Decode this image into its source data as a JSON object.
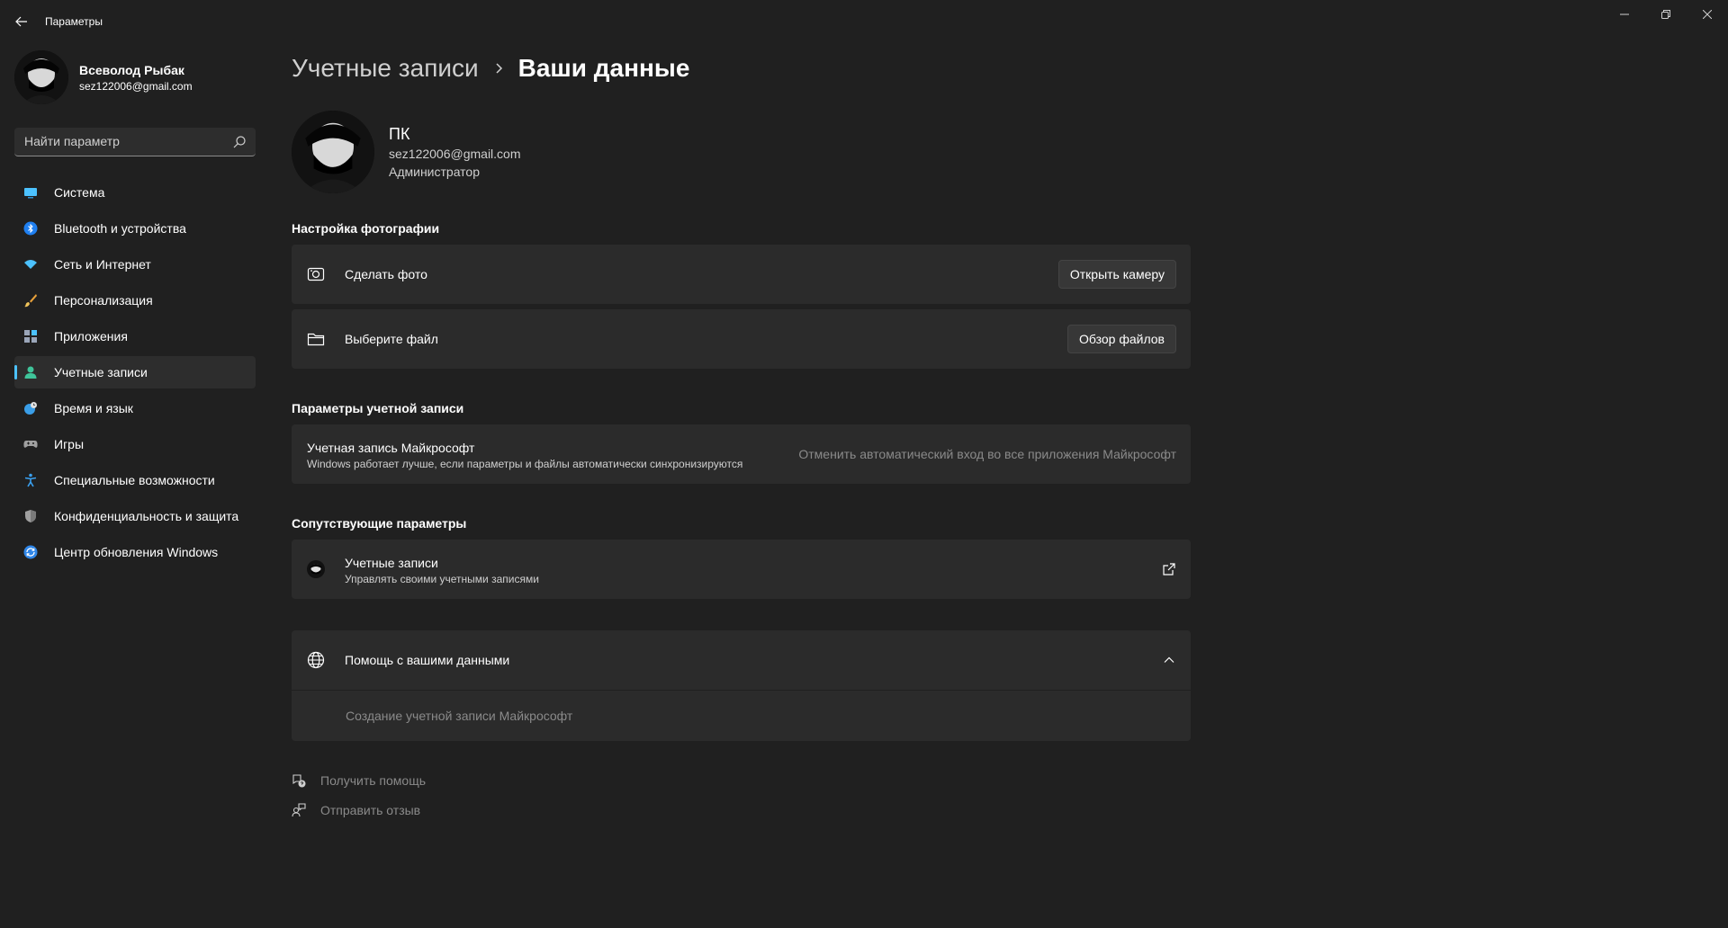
{
  "window": {
    "title": "Параметры",
    "minimize_icon": "minimize-icon",
    "maximize_icon": "restore-icon",
    "close_icon": "close-icon"
  },
  "profile": {
    "name": "Всеволод Рыбак",
    "email": "sez122006@gmail.com"
  },
  "search": {
    "placeholder": "Найти параметр"
  },
  "sidebar": {
    "items": [
      {
        "label": "Система",
        "icon": "system-icon",
        "color": "#4cc2ff",
        "active": false
      },
      {
        "label": "Bluetooth и устройства",
        "icon": "bluetooth-icon",
        "color": "#1f7ff0",
        "active": false
      },
      {
        "label": "Сеть и Интернет",
        "icon": "wifi-icon",
        "color": "#4cc2ff",
        "active": false
      },
      {
        "label": "Персонализация",
        "icon": "brush-icon",
        "color": "#e8a13a",
        "active": false
      },
      {
        "label": "Приложения",
        "icon": "apps-icon",
        "color": "#9aa5b8",
        "active": false
      },
      {
        "label": "Учетные записи",
        "icon": "person-icon",
        "color": "#3fc49a",
        "active": true
      },
      {
        "label": "Время и язык",
        "icon": "globe-clock-icon",
        "color": "#3a9ee8",
        "active": false
      },
      {
        "label": "Игры",
        "icon": "gamepad-icon",
        "color": "#a0a0a0",
        "active": false
      },
      {
        "label": "Специальные возможности",
        "icon": "accessibility-icon",
        "color": "#3aa0f0",
        "active": false
      },
      {
        "label": "Конфиденциальность и защита",
        "icon": "shield-icon",
        "color": "#a0a0a0",
        "active": false
      },
      {
        "label": "Центр обновления Windows",
        "icon": "update-icon",
        "color": "#2f86e8",
        "active": false
      }
    ]
  },
  "breadcrumb": {
    "parent": "Учетные записи",
    "current": "Ваши данные"
  },
  "user": {
    "name": "ПК",
    "email": "sez122006@gmail.com",
    "role": "Администратор"
  },
  "photo_settings": {
    "title": "Настройка фотографии",
    "take_photo": {
      "label": "Сделать фото",
      "button": "Открыть камеру"
    },
    "choose_file": {
      "label": "Выберите файл",
      "button": "Обзор файлов"
    }
  },
  "account_settings": {
    "title": "Параметры учетной записи",
    "ms_account": {
      "title": "Учетная запись Майкрософт",
      "subtitle": "Windows работает лучше, если параметры и файлы автоматически синхронизируются",
      "link": "Отменить автоматический вход во все приложения Майкрософт"
    }
  },
  "related": {
    "title": "Сопутствующие параметры",
    "accounts": {
      "title": "Учетные записи",
      "subtitle": "Управлять своими учетными записями"
    }
  },
  "help": {
    "title": "Помощь с вашими данными",
    "link": "Создание учетной записи Майкрософт"
  },
  "footer": {
    "get_help": "Получить помощь",
    "feedback": "Отправить отзыв"
  }
}
